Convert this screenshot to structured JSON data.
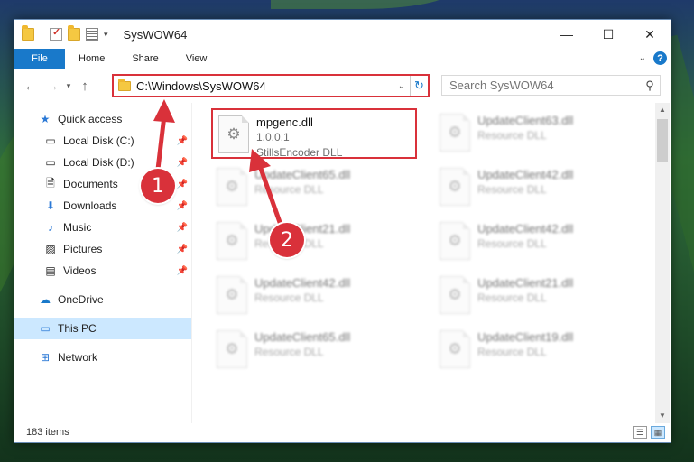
{
  "window": {
    "title": "SysWOW64",
    "minimize": "—",
    "maximize": "☐",
    "close": "✕"
  },
  "ribbon": {
    "tabs": [
      "File",
      "Home",
      "Share",
      "View"
    ]
  },
  "address": {
    "path": "C:\\Windows\\SysWOW64",
    "search_placeholder": "Search SysWOW64"
  },
  "navigation": {
    "quick_access": "Quick access",
    "pinned": [
      {
        "label": "Local Disk (C:)",
        "icon": "drive-icon"
      },
      {
        "label": "Local Disk (D:)",
        "icon": "drive-icon"
      },
      {
        "label": "Documents",
        "icon": "documents-icon"
      },
      {
        "label": "Downloads",
        "icon": "downloads-icon"
      },
      {
        "label": "Music",
        "icon": "music-icon"
      },
      {
        "label": "Pictures",
        "icon": "pictures-icon"
      },
      {
        "label": "Videos",
        "icon": "videos-icon"
      }
    ],
    "onedrive": "OneDrive",
    "this_pc": "This PC",
    "network": "Network"
  },
  "files": {
    "highlighted": {
      "name": "mpgenc.dll",
      "version": "1.0.0.1",
      "description": "StillsEncoder DLL"
    },
    "items": [
      {
        "name": "UpdateClient63.dll",
        "description": "Resource DLL"
      },
      {
        "name": "UpdateClient65.dll",
        "description": "Resource DLL"
      },
      {
        "name": "UpdateClient42.dll",
        "description": "Resource DLL"
      },
      {
        "name": "UpdateClient21.dll",
        "description": "Resource DLL"
      },
      {
        "name": "UpdateClient42.dll",
        "description": "Resource DLL"
      },
      {
        "name": "UpdateClient42.dll",
        "description": "Resource DLL"
      },
      {
        "name": "UpdateClient21.dll",
        "description": "Resource DLL"
      },
      {
        "name": "UpdateClient65.dll",
        "description": "Resource DLL"
      },
      {
        "name": "UpdateClient19.dll",
        "description": "Resource DLL"
      }
    ]
  },
  "status": {
    "item_count": "183 items"
  },
  "callouts": {
    "step1": "1",
    "step2": "2",
    "color": "#d9313a"
  }
}
